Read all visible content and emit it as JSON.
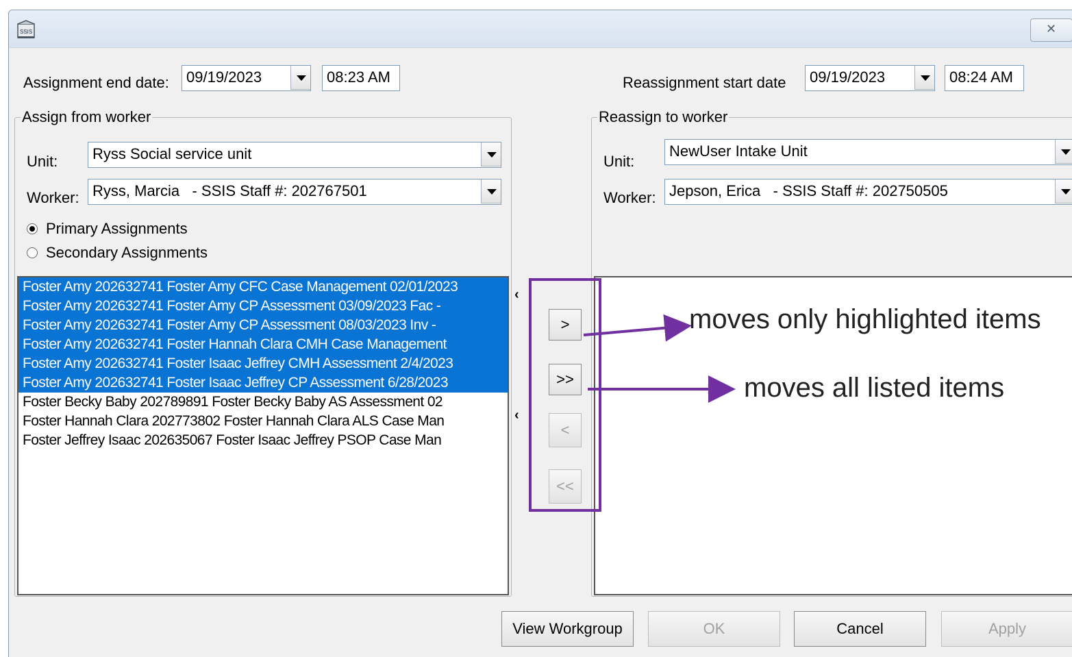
{
  "dialog": {
    "close_label": "✕"
  },
  "assignment_end": {
    "label": "Assignment end date:",
    "date": "09/19/2023",
    "time": "08:23 AM"
  },
  "reassignment_start": {
    "label": "Reassignment start date",
    "date": "09/19/2023",
    "time": "08:24 AM"
  },
  "assign_from": {
    "title": "Assign from worker",
    "unit_label": "Unit:",
    "unit_value": "Ryss Social service unit",
    "worker_label": "Worker:",
    "worker_value": "Ryss, Marcia   - SSIS Staff #: 202767501",
    "primary_label": "Primary Assignments",
    "secondary_label": "Secondary Assignments",
    "selected_radio": "primary",
    "items": [
      {
        "text": "Foster Amy 202632741 Foster Amy CFC Case Management 02/01/2023",
        "selected": true
      },
      {
        "text": "Foster Amy 202632741 Foster Amy CP Assessment 03/09/2023 Fac -",
        "selected": true
      },
      {
        "text": "Foster Amy 202632741 Foster Amy CP Assessment 08/03/2023 Inv -",
        "selected": true
      },
      {
        "text": "Foster Amy 202632741 Foster Hannah Clara CMH Case Management",
        "selected": true
      },
      {
        "text": "Foster Amy 202632741 Foster Isaac Jeffrey CMH Assessment 2/4/2023",
        "selected": true
      },
      {
        "text": "Foster Amy 202632741 Foster Isaac Jeffrey CP Assessment 6/28/2023",
        "selected": true
      },
      {
        "text": "Foster Becky Baby 202789891 Foster Becky Baby AS Assessment 02",
        "selected": false
      },
      {
        "text": "Foster Hannah Clara 202773802 Foster Hannah Clara ALS Case Man",
        "selected": false
      },
      {
        "text": "Foster Jeffrey Isaac 202635067 Foster Isaac Jeffrey PSOP Case Man",
        "selected": false
      }
    ]
  },
  "reassign_to": {
    "title": "Reassign to worker",
    "unit_label": "Unit:",
    "unit_value": "NewUser Intake Unit",
    "worker_label": "Worker:",
    "worker_value": "Jepson, Erica   - SSIS Staff #: 202750505"
  },
  "move_buttons": {
    "move_selected": ">",
    "move_all": ">>",
    "remove_selected": "<",
    "remove_all": "<<"
  },
  "annotations": {
    "move_selected_note": "moves only highlighted items",
    "move_all_note": "moves all listed items",
    "color": "#7030a0"
  },
  "footer": {
    "view_workgroup": "View Workgroup",
    "ok": "OK",
    "cancel": "Cancel",
    "apply": "Apply"
  },
  "colors": {
    "selection": "#0a74d4",
    "window_bg": "#f0f0f0"
  }
}
